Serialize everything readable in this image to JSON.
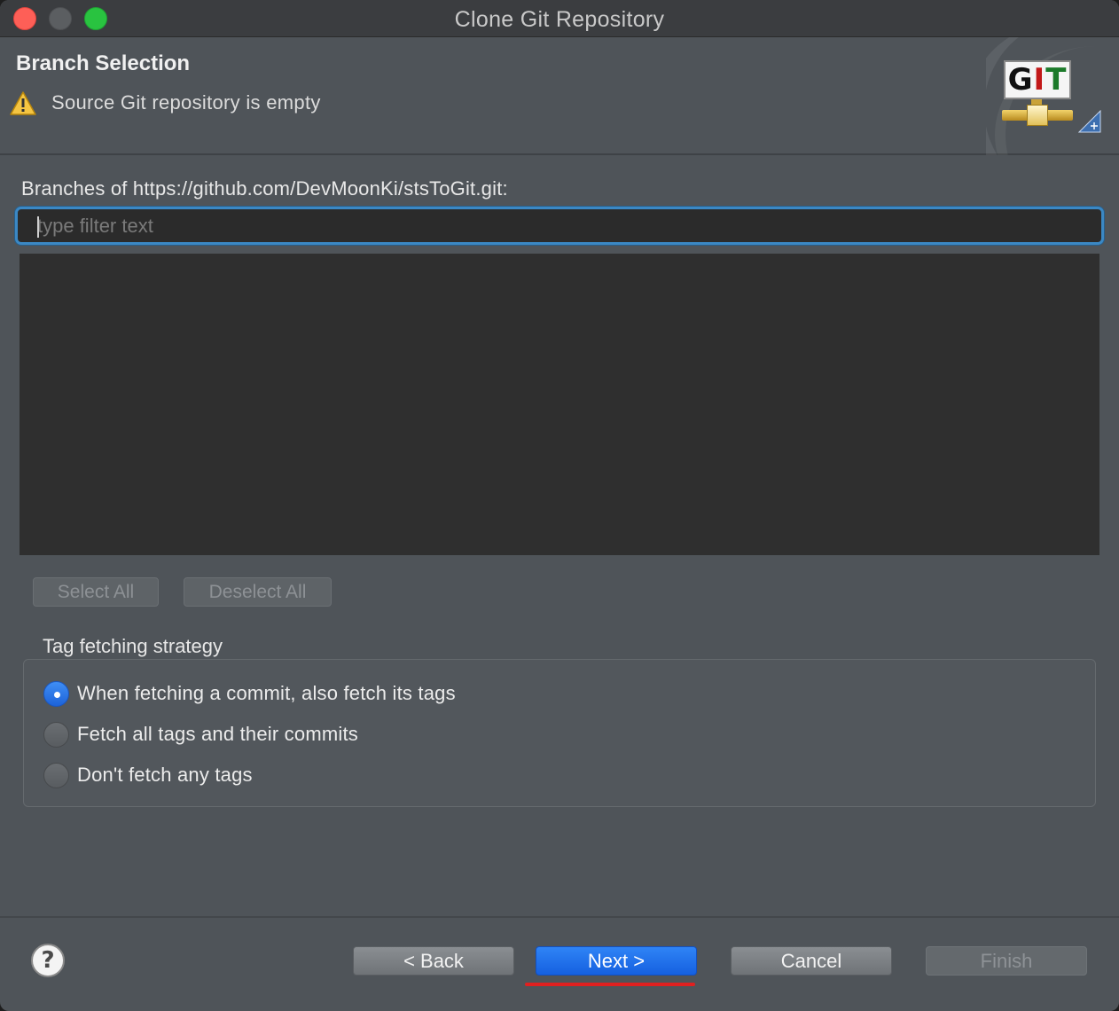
{
  "window": {
    "title": "Clone Git Repository"
  },
  "header": {
    "title": "Branch Selection",
    "message": "Source Git repository is empty",
    "logo": {
      "g": "G",
      "i": "I",
      "t": "T"
    }
  },
  "branches": {
    "label": "Branches of https://github.com/DevMoonKi/stsToGit.git:",
    "filter_placeholder": "type filter text",
    "items": []
  },
  "selection_buttons": {
    "select_all": "Select All",
    "deselect_all": "Deselect All"
  },
  "tag_strategy": {
    "label": "Tag fetching strategy",
    "options": [
      {
        "label": "When fetching a commit, also fetch its tags",
        "selected": true
      },
      {
        "label": "Fetch all tags and their commits",
        "selected": false
      },
      {
        "label": "Don't fetch any tags",
        "selected": false
      }
    ]
  },
  "footer": {
    "help_label": "?",
    "back_label": "< Back",
    "next_label": "Next >",
    "cancel_label": "Cancel",
    "finish_label": "Finish"
  },
  "colors": {
    "accent": "#1d63d9",
    "focus_ring": "#3b88c4",
    "annotation_underline": "#e02020"
  }
}
